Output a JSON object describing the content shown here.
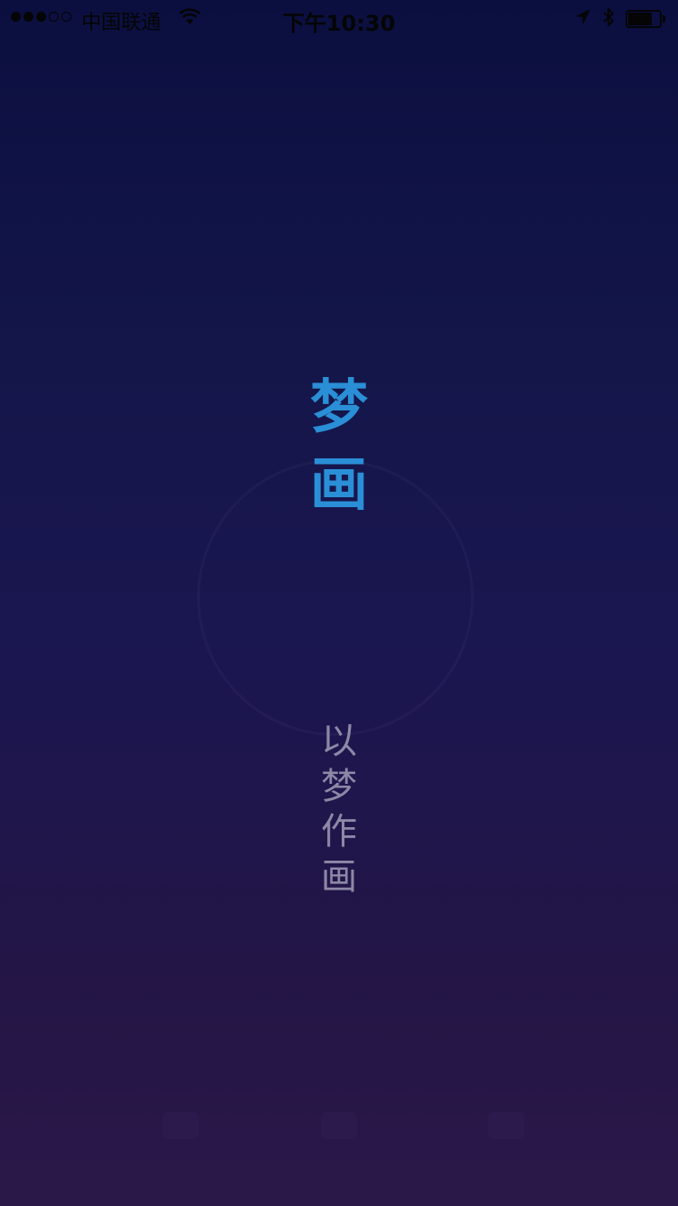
{
  "status_bar": {
    "carrier": "中国联通",
    "time": "下午10:30",
    "signal_bars_filled": 3,
    "signal_bars_total": 5,
    "battery_level": 0.75,
    "icons": [
      "wifi-icon",
      "location-arrow-icon",
      "bluetooth-icon",
      "battery-icon"
    ]
  },
  "splash": {
    "title_chars": [
      "梦",
      "画"
    ],
    "slogan_chars": [
      "以",
      "梦",
      "作",
      "画"
    ]
  },
  "colors": {
    "title": "#2a8fd6",
    "slogan": "#8d88a6",
    "background_top": "#0b0f3f",
    "background_bottom": "#2a1848"
  }
}
